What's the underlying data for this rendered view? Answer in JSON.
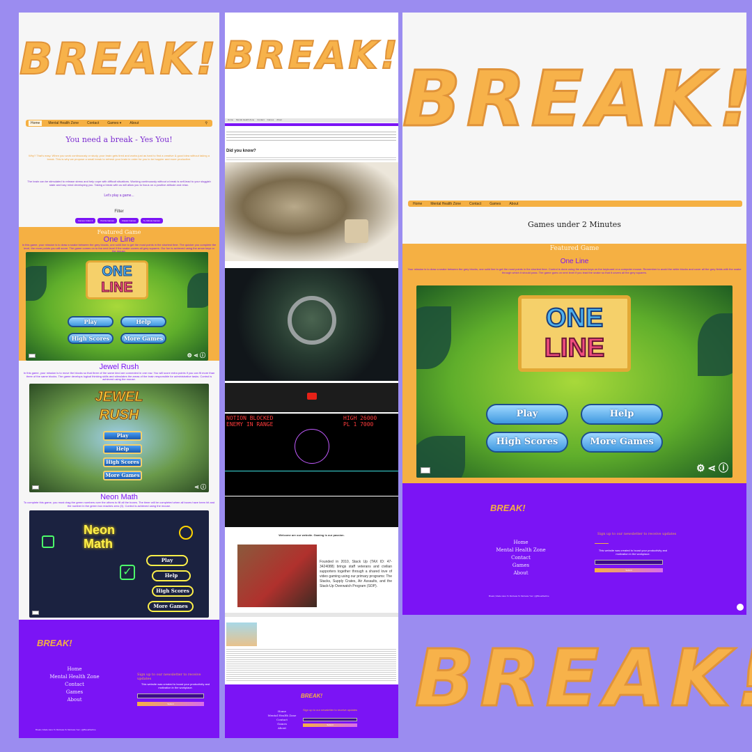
{
  "brand": {
    "logo_text": "BREAK!"
  },
  "panel1": {
    "nav": [
      "Home",
      "Mental Health Zone",
      "Contact",
      "Games ▾",
      "About"
    ],
    "headline": "You need a break - Yes You!",
    "intro": "Why? That's easy. When you work continuously or study, your brain gets tired and works just as hard to find a creative & good idea without taking a break. This is why we propose a small break to refresh your brain in order for you to be happier and more productive.",
    "intro2": "The brain can be stimulated to release stress and help cope with difficult situations. Working continuously without a break is self-lead to your sluggish state and lazy mind developing you. Taking a break with us will allow you to focus on a positive attitude and relax.",
    "play_prompt": "Let's play a game...",
    "filter_label": "Filter",
    "filters": [
      "Games Under 2",
      "Puzzle Games",
      "Classic Games",
      "5+ Minute Games"
    ],
    "featured_label": "Featured Game",
    "games": [
      {
        "title": "One Line",
        "desc": "In this game, your mission is to draw a snake between the grey blocks, one solid line to get the most points in the shortest time. The quicker you complete the level, the more points you will score. The game comes on to the next level if the snake covers all grey squares. Our fun is achieved using the arrow keys or the mouse."
      },
      {
        "title": "Jewel Rush",
        "desc": "In this game, your mission is to move the blocks so that three of the same kind are connected in one row. You will score extra points if you can fit more than three of the same blocks. The game develops logical thinking skills and stimulates the areas of the brain responsible for administrative tasks. Control is achieved using the mouse."
      },
      {
        "title": "Neon Math",
        "desc": "To complete this game, you must drag the green numbers over the others to fill all the boxes. The timer will be completed when all boxes have been hit and the number in the green box reaches zero (0). Control is achieved using the mouse."
      }
    ],
    "oneline_buttons": [
      "Play",
      "Help",
      "High Scores",
      "More Games"
    ],
    "jewel_buttons": [
      "Play",
      "Help",
      "High Scores",
      "More Games"
    ],
    "neon_buttons": [
      "Play",
      "Help",
      "High Scores",
      "More Games"
    ],
    "jewel_logo": [
      "JEWEL",
      "RUSH"
    ],
    "neon_logo": [
      "Neon",
      "Math"
    ],
    "oneline_logo": [
      "ONE",
      "LINE"
    ]
  },
  "footer": {
    "logo": "BREAK!",
    "links": [
      "Home",
      "Mental Health Zone",
      "Contact",
      "Games",
      "About"
    ],
    "newsletter_title": "Sign up to our newsletter to receive updates",
    "newsletter_text": "This website was created to boost your productivity and motivation in the workplace.",
    "submit": "Submit",
    "copyright": "Break | Made Here To Motivate To Motivate You! | @BreakSaOne"
  },
  "panel2": {
    "nav": [
      "Home",
      "Mental Health Zone",
      "Contact",
      "Games",
      "About"
    ],
    "heading": "Did you know?",
    "welcome_heading": "Welcome are our website. Gaming is our passion.",
    "org_text": "Founded in 2010, Stack Up (TAX ID: 47-3424088) brings staff veterans and civilian supporters together through a shared love of video gaming using our primary programs: The Stacks, Supply Crates, Air Assaults, and the Stack-Up Overwatch Program (SOP).",
    "footer_newsletter": "Sign up to our newsletter to receive updates",
    "game_text": [
      "NOTION BLOCKED",
      "ENEMY IN RANGE",
      "HIGH",
      "26000",
      "PL 1",
      "7000"
    ]
  },
  "panel3": {
    "nav": [
      "Home",
      "Mental Health Zone",
      "Contact",
      "Games",
      "About"
    ],
    "heading": "Games under 2 Minutes",
    "featured_label": "Featured Game",
    "game_title": "One Line",
    "game_desc": "Your mission is to draw a snake between the grey blocks, one solid line to get the most points in the shortest time. Control is done using the arrow keys on the keyboard or a computer mouse. Remember to avoid the white blocks and cover all the grey fields with the snake through which it should pass. The game goes on next level if you lead the snake so that it covers all the grey squares.",
    "buttons": [
      "Play",
      "Help",
      "High Scores",
      "More Games"
    ]
  },
  "bottom_logo": "BREAK!",
  "colors": {
    "background": "#9b8cf0",
    "orange": "#f5b043",
    "purple": "#7b14f5"
  }
}
